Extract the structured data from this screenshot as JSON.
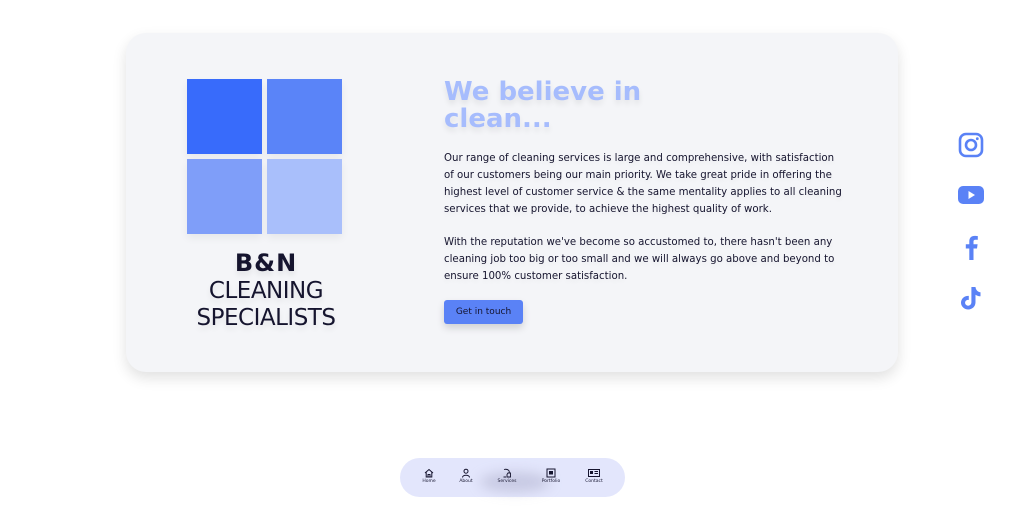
{
  "brand": {
    "logo_colors": [
      "#386bfb",
      "#5a84f8",
      "#7f9ef9",
      "#a9bffb"
    ],
    "line1": "B&N",
    "line2": "CLEANING",
    "line3": "SPECIALISTS"
  },
  "hero": {
    "headline_line1": "We believe in",
    "headline_line2": "clean...",
    "paragraph1": "Our range of cleaning services is large and comprehensive, with satisfaction of our customers being our main priority. We take great pride in offering the highest level of customer service & the same mentality applies to all cleaning services that we provide, to achieve the highest quality of work.",
    "paragraph2": "With the reputation we've become so accustomed to, there hasn't been any cleaning job too big or too small and we will always go above and beyond to ensure 100% customer satisfaction.",
    "cta_label": "Get in touch"
  },
  "social": [
    {
      "name": "instagram",
      "icon": "instagram-icon"
    },
    {
      "name": "youtube",
      "icon": "youtube-icon"
    },
    {
      "name": "facebook",
      "icon": "facebook-icon"
    },
    {
      "name": "tiktok",
      "icon": "tiktok-icon"
    }
  ],
  "nav": {
    "items": [
      {
        "label": "Home",
        "icon": "home-icon"
      },
      {
        "label": "About",
        "icon": "user-icon"
      },
      {
        "label": "Services",
        "icon": "vacuum-icon"
      },
      {
        "label": "Portfolio",
        "icon": "image-icon"
      },
      {
        "label": "Contact",
        "icon": "contact-card-icon"
      }
    ]
  },
  "colors": {
    "accent": "#5a82f6",
    "headline": "#a6bcfd",
    "text": "#15142e",
    "card_bg": "#f4f5f8",
    "nav_bg": "#e3e6fc"
  }
}
